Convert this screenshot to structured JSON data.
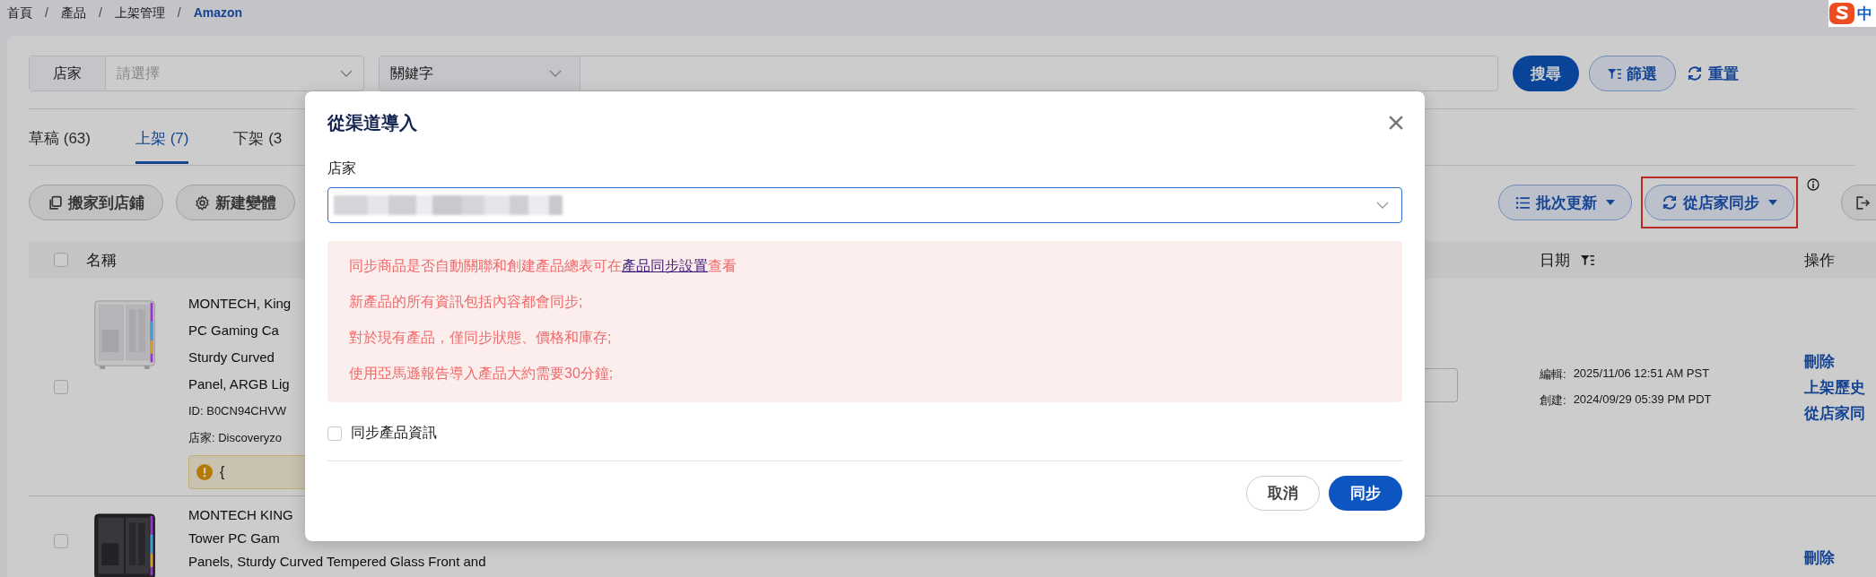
{
  "ime": {
    "label": "中"
  },
  "breadcrumb": [
    {
      "label": "首頁",
      "current": false,
      "separator": "/"
    },
    {
      "label": "產品",
      "current": false,
      "separator": "/"
    },
    {
      "label": "上架管理",
      "current": false,
      "separator": "/"
    },
    {
      "label": "Amazon",
      "current": true
    }
  ],
  "filters": {
    "store": {
      "label": "店家",
      "placeholder": "請選擇"
    },
    "keyword": {
      "field": "關鍵字"
    },
    "buttons": [
      {
        "label": "搜尋",
        "kind": "primary"
      },
      {
        "label": "篩選",
        "kind": "outline"
      },
      {
        "label": "重置",
        "kind": "text"
      }
    ]
  },
  "tabs": [
    {
      "label": "草稿 (63)",
      "selected": false
    },
    {
      "label": "上架 (7)",
      "selected": true
    },
    {
      "label": "下架 (3",
      "selected": false
    }
  ],
  "toolbar": {
    "left": [
      {
        "label": "搬家到店鋪",
        "kind": "copy"
      },
      {
        "label": "新建變體",
        "kind": "gear"
      }
    ],
    "right": [
      {
        "label": "批次更新",
        "kind": "list",
        "highlighted": false
      },
      {
        "label": "從店家同步",
        "kind": "sync",
        "highlighted": true
      }
    ]
  },
  "table": {
    "select_all": {
      "checked": false
    },
    "columns": [
      {
        "label": "名稱"
      },
      {
        "label": "日期",
        "filter": true
      },
      {
        "label": "操作"
      }
    ],
    "rows": [
      {
        "checked": false,
        "title_lines": [
          "MONTECH, King",
          "PC Gaming Ca",
          "Sturdy Curved",
          "Panel, ARGB Lig"
        ],
        "id": "ID: B0CN94CHVW",
        "store": "店家: Discoveryzo",
        "warning": "{",
        "dates": [
          {
            "label": "編輯:",
            "value": "2025/11/06 12:51 AM PST"
          },
          {
            "label": "創建:",
            "value": "2024/09/29 05:39 PM PDT"
          }
        ],
        "actions": [
          "刪除",
          "上架歷史",
          "從店家同"
        ]
      },
      {
        "checked": false,
        "title_lines": [
          "MONTECH KING",
          "Tower PC Gam",
          "Panels, Sturdy Curved Tempered Glass Front and"
        ],
        "dates": [],
        "actions": [
          "刪除"
        ]
      }
    ]
  },
  "modal": {
    "title": "從渠道導入",
    "store_label": "店家",
    "notice": [
      {
        "text": "同步商品是否自動關聯和創建產品總表可在",
        "link": "產品同步設置",
        "after": "查看"
      },
      {
        "text": "新產品的所有資訊包括內容都會同步;"
      },
      {
        "text": "對於現有產品，僅同步狀態、價格和庫存;"
      },
      {
        "text": "使用亞馬遜報告導入產品大約需要30分鐘;"
      }
    ],
    "sync_info": {
      "label": "同步產品資訊",
      "checked": false
    },
    "buttons": [
      {
        "label": "取消",
        "kind": "secondary"
      },
      {
        "label": "同步",
        "kind": "primary"
      }
    ]
  }
}
